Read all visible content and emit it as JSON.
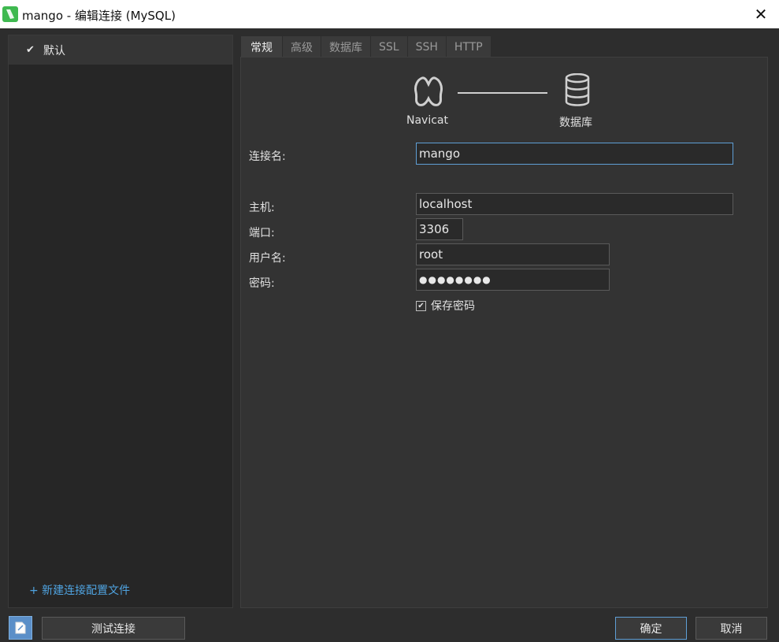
{
  "window": {
    "title": "mango - 编辑连接 (MySQL)",
    "close_glyph": "✕"
  },
  "sidebar": {
    "profiles": [
      {
        "label": "默认",
        "selected": true
      }
    ],
    "new_profile_label": "+ 新建连接配置文件"
  },
  "tabs": [
    {
      "label": "常规",
      "active": true
    },
    {
      "label": "高级",
      "active": false
    },
    {
      "label": "数据库",
      "active": false
    },
    {
      "label": "SSL",
      "active": false
    },
    {
      "label": "SSH",
      "active": false
    },
    {
      "label": "HTTP",
      "active": false
    }
  ],
  "diagram": {
    "left_label": "Navicat",
    "right_label": "数据库"
  },
  "form": {
    "connection_name": {
      "label": "连接名:",
      "value": "mango"
    },
    "host": {
      "label": "主机:",
      "value": "localhost"
    },
    "port": {
      "label": "端口:",
      "value": "3306"
    },
    "username": {
      "label": "用户名:",
      "value": "root"
    },
    "password": {
      "label": "密码:",
      "value": "●●●●●●●●"
    },
    "save_password": {
      "label": "保存密码",
      "checked": true
    }
  },
  "buttons": {
    "test_connection": "测试连接",
    "ok": "确定",
    "cancel": "取消"
  },
  "colors": {
    "accent": "#5f9fd6",
    "link": "#4fa3e0",
    "app_icon": "#3fb950"
  }
}
